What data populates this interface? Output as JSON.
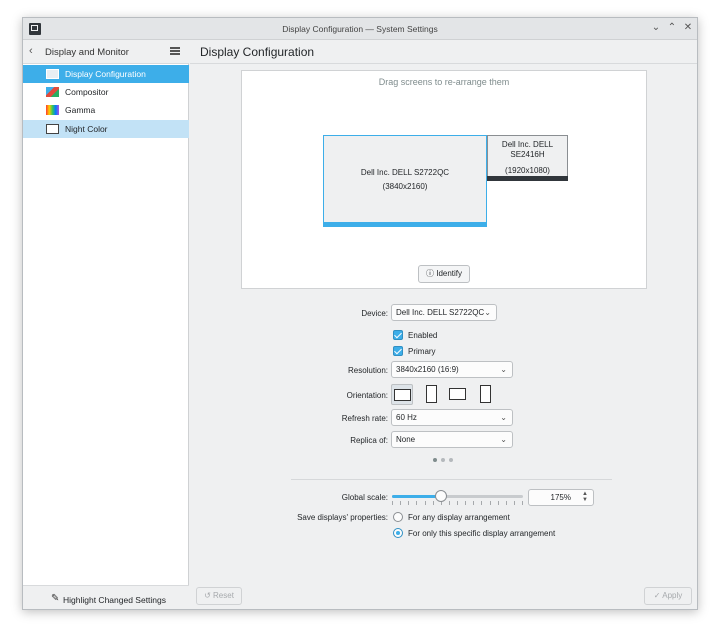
{
  "window": {
    "title": "Display Configuration — System Settings",
    "minimize_icon": "chevron-down-icon",
    "maximize_icon": "chevron-up-icon",
    "close_icon": "close-icon"
  },
  "sidebar": {
    "header_title": "Display and Monitor",
    "items": [
      {
        "label": "Display Configuration",
        "icon": "monitor-icon",
        "state": "selected"
      },
      {
        "label": "Compositor",
        "icon": "compositor-icon",
        "state": "normal"
      },
      {
        "label": "Gamma",
        "icon": "gamma-icon",
        "state": "normal"
      },
      {
        "label": "Night Color",
        "icon": "monitor-icon",
        "state": "hover"
      }
    ],
    "footer_label": "Highlight Changed Settings"
  },
  "main": {
    "title": "Display Configuration",
    "canvas_hint": "Drag screens to re-arrange them",
    "screens": [
      {
        "name": "Dell Inc. DELL S2722QC",
        "resolution": "(3840x2160)",
        "primary": true
      },
      {
        "name": "Dell Inc. DELL SE2416H",
        "resolution": "(1920x1080)",
        "primary": false
      }
    ],
    "identify_label": "Identify"
  },
  "form": {
    "device_label": "Device:",
    "device_value": "Dell Inc. DELL S2722QC",
    "enabled_label": "Enabled",
    "enabled_checked": true,
    "primary_label": "Primary",
    "primary_checked": true,
    "resolution_label": "Resolution:",
    "resolution_value": "3840x2160 (16:9)",
    "orientation_label": "Orientation:",
    "orientation_options": [
      "landscape",
      "portrait-left",
      "landscape-flipped",
      "portrait-right"
    ],
    "orientation_selected": "landscape",
    "refresh_label": "Refresh rate:",
    "refresh_value": "60 Hz",
    "replica_label": "Replica of:",
    "replica_value": "None",
    "pager_pages": 3,
    "pager_current": 1,
    "scale_label": "Global scale:",
    "scale_value": "175%",
    "scale_fraction": 0.375,
    "save_label": "Save displays' properties:",
    "save_options": [
      "For any display arrangement",
      "For only this specific display arrangement"
    ],
    "save_selected": 1
  },
  "footer": {
    "reset_label": "Reset",
    "apply_label": "Apply"
  },
  "colors": {
    "accent": "#3daee9",
    "window_bg": "#eff0f1"
  }
}
